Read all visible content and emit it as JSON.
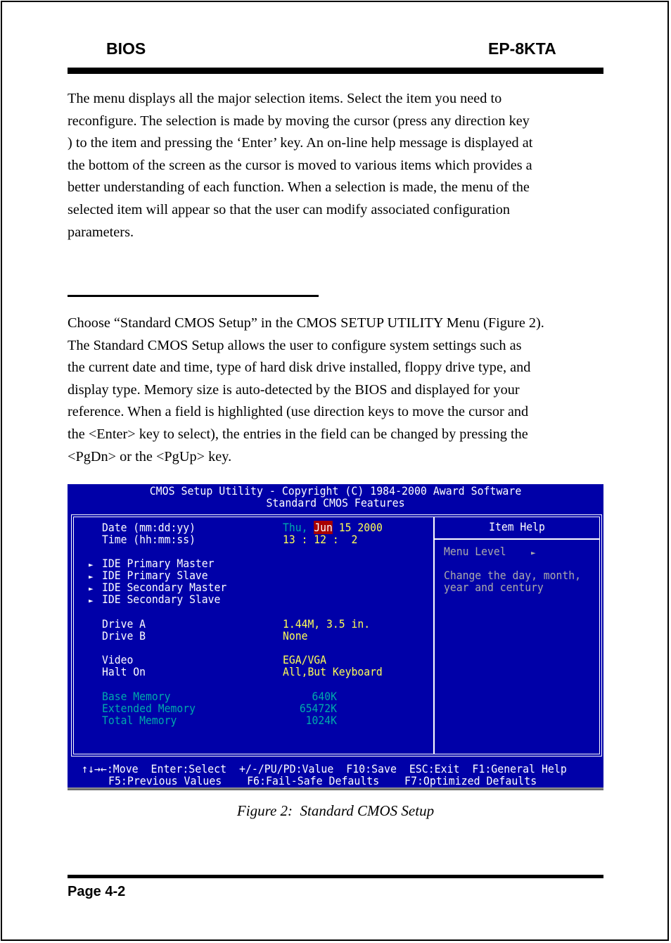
{
  "header": {
    "left": "BIOS",
    "right": "EP-8KTA"
  },
  "intro_paragraph": [
    "The menu displays all the major selection items. Select the item you need to",
    "reconfigure.  The selection is made by moving the cursor (press any direction key",
    ") to the item and pressing the ‘Enter’ key. An on-line help message is displayed at",
    "the bottom of the screen as the cursor is moved to various items which provides a",
    "better understanding of each function. When a selection is made, the menu of the",
    "selected item will appear so that the user can modify associated configuration",
    "parameters."
  ],
  "section_paragraph": [
    "Choose “Standard CMOS Setup” in the CMOS SETUP UTILITY Menu (Figure 2).",
    "The  Standard CMOS Setup allows the user to configure system settings such as",
    "the current date and time, type of hard disk drive installed, floppy drive type, and",
    "display type. Memory size is auto-detected by the BIOS and displayed for your",
    "reference. When a field is highlighted (use direction keys to move the cursor and",
    "the <Enter> key to select), the entries in the field can be changed by pressing the",
    "<PgDn> or the <PgUp> key."
  ],
  "bios": {
    "title": "CMOS Setup Utility - Copyright (C) 1984-2000 Award Software",
    "subtitle": "Standard CMOS Features",
    "colors": {
      "background": "#0000a8",
      "label": "#ffffff",
      "value": "#ffff55",
      "info": "#00aaaa",
      "highlight": "#a80000",
      "help_text": "#aaaaaa"
    },
    "date": {
      "label": "Date (mm:dd:yy)",
      "weekday": "Thu,",
      "month": "Jun",
      "day_year": "15 2000"
    },
    "time": {
      "label": "Time (hh:mm:ss)",
      "value": "13 : 12 :  2"
    },
    "submenus": [
      {
        "icon": "right-triangle-icon",
        "label": "IDE Primary Master"
      },
      {
        "icon": "right-triangle-icon",
        "label": "IDE Primary Slave"
      },
      {
        "icon": "right-triangle-icon",
        "label": "IDE Secondary Master"
      },
      {
        "icon": "right-triangle-icon",
        "label": "IDE Secondary Slave"
      }
    ],
    "settings": [
      {
        "label": "Drive A",
        "value": "1.44M, 3.5 in."
      },
      {
        "label": "Drive B",
        "value": "None"
      },
      {
        "label": "Video",
        "value": "EGA/VGA"
      },
      {
        "label": "Halt On",
        "value": "All,But Keyboard"
      }
    ],
    "memory": [
      {
        "label": "Base Memory",
        "value": "640K"
      },
      {
        "label": "Extended Memory",
        "value": "65472K"
      },
      {
        "label": "Total Memory",
        "value": "1024K"
      }
    ],
    "help": {
      "title": "Item Help",
      "menu_level_label": "Menu Level",
      "menu_level_icon": "right-triangle-icon",
      "text_lines": [
        "Change the day, month,",
        "year and century"
      ]
    },
    "footer": {
      "line1": [
        {
          "key": "↑↓→←",
          "action": "Move",
          "icon": "arrow-keys-icon"
        },
        {
          "key": "Enter",
          "action": "Select"
        },
        {
          "key": "+/-/PU/PD",
          "action": "Value"
        },
        {
          "key": "F10",
          "action": "Save"
        },
        {
          "key": "ESC",
          "action": "Exit"
        },
        {
          "key": "F1",
          "action": "General Help"
        }
      ],
      "line2": [
        {
          "key": "F5",
          "action": "Previous Values"
        },
        {
          "key": "F6",
          "action": "Fail-Safe Defaults"
        },
        {
          "key": "F7",
          "action": "Optimized Defaults"
        }
      ],
      "line1_text": "↑↓→←:Move  Enter:Select  +/-/PU/PD:Value  F10:Save  ESC:Exit  F1:General Help",
      "line2_text": "F5:Previous Values    F6:Fail-Safe Defaults    F7:Optimized Defaults"
    }
  },
  "figure_caption": "Figure 2:  Standard CMOS Setup",
  "page_number": "Page 4-2"
}
